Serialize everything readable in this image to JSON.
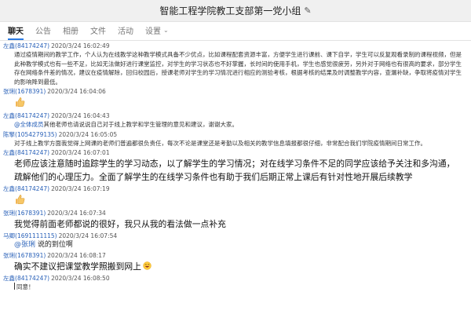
{
  "window": {
    "title": "智能工程学院教工支部第一党小组"
  },
  "tabs": [
    {
      "label": "聊天",
      "active": true
    },
    {
      "label": "公告"
    },
    {
      "label": "相册"
    },
    {
      "label": "文件"
    },
    {
      "label": "活动"
    },
    {
      "label": "设置"
    }
  ],
  "messages": [
    {
      "sender": "左鑫",
      "qq": "84174247",
      "time": "2020/3/24 16:02:49",
      "text": "通过疫情期间的教学工作，个人认为在线教学这种教学模式具备不少优点，比如课程配套资源丰富，方便学生进行课前、课下自学，学生可以反复观看录制的课程视频，但是此种教学模式也有一些不足，比如无法做好进行课堂监控，对学生的学习状态也不好掌握，长时间的使用手机，学生也感觉很疲劳，另外对于网络也有很高的要求，部分学生存在网络条件差的情况，建议在疫情解除，回归校园后，授课老师对学生的学习情况进行相应的测验考核，根据考核的结果及时调整教学内容，查漏补缺，争取将疫情对学生的影响降到最低。"
    },
    {
      "sender": "张琍",
      "qq": "1678391",
      "time": "2020/3/24 16:04:06",
      "thumb": true
    },
    {
      "sender": "左鑫",
      "qq": "84174247",
      "time": "2020/3/24 16:04:43",
      "mention": "@全体成员",
      "text": "其他老师也请说说自己对于线上教学和学生管理的意见和建议，谢谢大家。"
    },
    {
      "sender": "陈擎",
      "qq": "1054279135",
      "time": "2020/3/24 16:05:05",
      "text": "对于线上教学方面我觉得上网课的老师们普遍都很负责任，每次不论是课堂还是考勤以及相关的教学信息填报都很仔细，非常配合我们学院疫情期间日常工作。"
    },
    {
      "sender": "左鑫",
      "qq": "84174247",
      "time": "2020/3/24 16:07:01",
      "big": true,
      "text": "老师应该注意随时追踪学生的学习动态，以了解学生的学习情况；对在线学习条件不足的同学应该给予关注和多沟通，疏解他们的心理压力。全面了解学生的在线学习条件也有助于我们后期正常上课后有针对性地开展后续教学"
    },
    {
      "sender": "左鑫",
      "qq": "84174247",
      "time": "2020/3/24 16:07:19",
      "thumb": true
    },
    {
      "sender": "张琍",
      "qq": "1678391",
      "time": "2020/3/24 16:07:34",
      "big": true,
      "text": "我觉得前面老师都说的很好，我只从我的看法做一点补充"
    },
    {
      "sender": "马卿",
      "qq": "1691111115",
      "time": "2020/3/24 16:07:54",
      "mid": true,
      "mention": "@张琍",
      "text": " 说的到位啊"
    },
    {
      "sender": "张琍",
      "qq": "1678391",
      "time": "2020/3/24 16:08:17",
      "big": true,
      "text": "确实不建议把课堂教学照搬到网上",
      "emoji": true
    },
    {
      "sender": "左鑫",
      "qq": "84174247",
      "time": "2020/3/24 16:08:50",
      "text": "同意！",
      "cursor": true
    }
  ]
}
